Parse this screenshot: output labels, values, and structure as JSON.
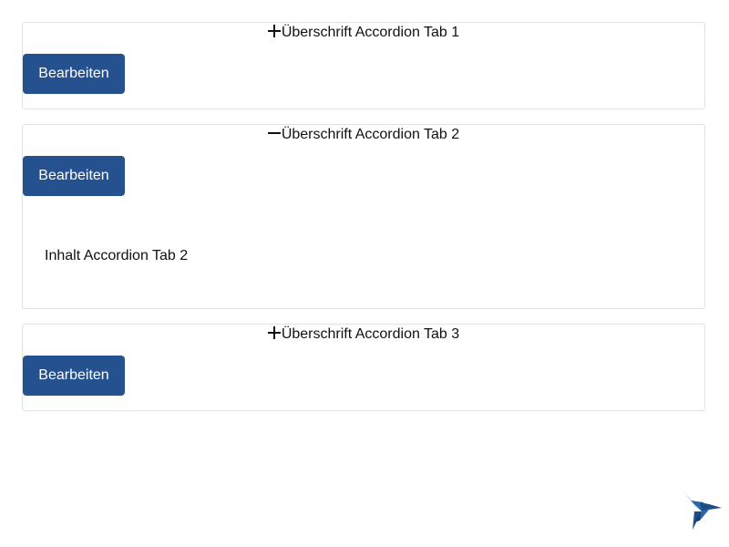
{
  "accordion": {
    "items": [
      {
        "icon": "plus-icon",
        "title": "Überschrift Accordion Tab 1",
        "button_label": "Bearbeiten",
        "expanded": false,
        "content": ""
      },
      {
        "icon": "minus-icon",
        "title": "Überschrift Accordion Tab 2",
        "button_label": "Bearbeiten",
        "expanded": true,
        "content": "Inhalt Accordion Tab 2"
      },
      {
        "icon": "plus-icon",
        "title": "Überschrift Accordion Tab 3",
        "button_label": "Bearbeiten",
        "expanded": false,
        "content": ""
      }
    ]
  },
  "colors": {
    "button_background": "#26518f",
    "button_text": "#ffffff",
    "border": "#e2e2e2",
    "logo": "#1d4f86"
  },
  "logo": {
    "icon": "hummingbird-logo-icon"
  }
}
